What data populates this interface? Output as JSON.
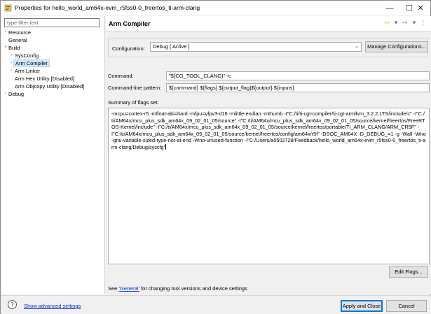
{
  "window": {
    "title": "Properties for hello_world_am64x-evm_r5fss0-0_freertos_ti-arm-clang",
    "icons": {
      "app": "eclipse-properties-icon",
      "minimize": "minimize-icon",
      "maximize": "maximize-icon",
      "close": "close-icon"
    },
    "controls": {
      "minimize": "—",
      "maximize": "☐",
      "close": "✕"
    }
  },
  "sidebar": {
    "filter_placeholder": "type filter text",
    "items": [
      {
        "label": "Resource",
        "expander": "›"
      },
      {
        "label": "General",
        "expander": ""
      },
      {
        "label": "Build",
        "expander": "˅"
      },
      {
        "label": "SysConfig",
        "expander": "›"
      },
      {
        "label": "Arm Compiler",
        "expander": "›"
      },
      {
        "label": "Arm Linker",
        "expander": "›"
      },
      {
        "label": "Arm Hex Utility  [Disabled]",
        "expander": ""
      },
      {
        "label": "Arm Objcopy Utility  [Disabled]",
        "expander": ""
      },
      {
        "label": "Debug",
        "expander": "›"
      }
    ]
  },
  "header": {
    "title": "Arm Compiler",
    "nav": {
      "back": "⇦",
      "back_menu": "▾",
      "forward": "⇨",
      "forward_menu": "▾",
      "more": "⋮"
    }
  },
  "configuration": {
    "label": "Configuration:",
    "value": "Debug  [ Active ]",
    "dropdown_chevron": "⌄",
    "manage_label": "Manage Configurations..."
  },
  "command": {
    "label": "Command:",
    "value": "\"${CG_TOOL_CLANG}\" -c"
  },
  "pattern": {
    "label": "Command-line pattern:",
    "value": "${command} ${flags} ${output_flag}${output} ${inputs}"
  },
  "summary": {
    "label": "Summary of flags set:",
    "text": "-mcpu=cortex-r5 -mfloat-abi=hard -mfpu=vfpv3-d16 -mlittle-endian -mthumb -I\"C:/ti/ti-cgt-compiler/ti-cgt-armllvm_3.2.2.LTS/include/c\" -I\"C:/ti/AM64x/mcu_plus_sdk_am64x_09_02_01_05/source\" -I\"C:/ti/AM64x/mcu_plus_sdk_am64x_09_02_01_05/source/kernel/freertos/FreeRTOS-Kernel/include\" -I\"C:/ti/AM64x/mcu_plus_sdk_am64x_09_02_01_05/source/kernel/freertos/portable/TI_ARM_CLANG/ARM_CR5F\" -I\"C:/ti/AM64x/mcu_plus_sdk_am64x_09_02_01_05/source/kernel/freertos/config/am64x/r5f\" -DSOC_AM64X -D_DEBUG_=1 -g -Wall -Wno-gnu-variable-sized-type-not-at-end -Wno-unused-function -I\"C:/Users/a0502728/Feedback/hello_world_am64x-evm_r5fss0-0_freertos_ti-arm-clang/Debug/syscfg\""
  },
  "edit_flags_label": "Edit Flags...",
  "footer_note": {
    "prefix": "See ",
    "link": "'General'",
    "suffix": " for changing tool versions and device settings"
  },
  "bottom": {
    "help_glyph": "?",
    "advanced_link": "Show advanced settings",
    "apply_label": "Apply and Close",
    "cancel_label": "Cancel"
  },
  "colors": {
    "link": "#0033cc",
    "selection": "#cce8ff",
    "default_button_border": "#0078d7"
  }
}
